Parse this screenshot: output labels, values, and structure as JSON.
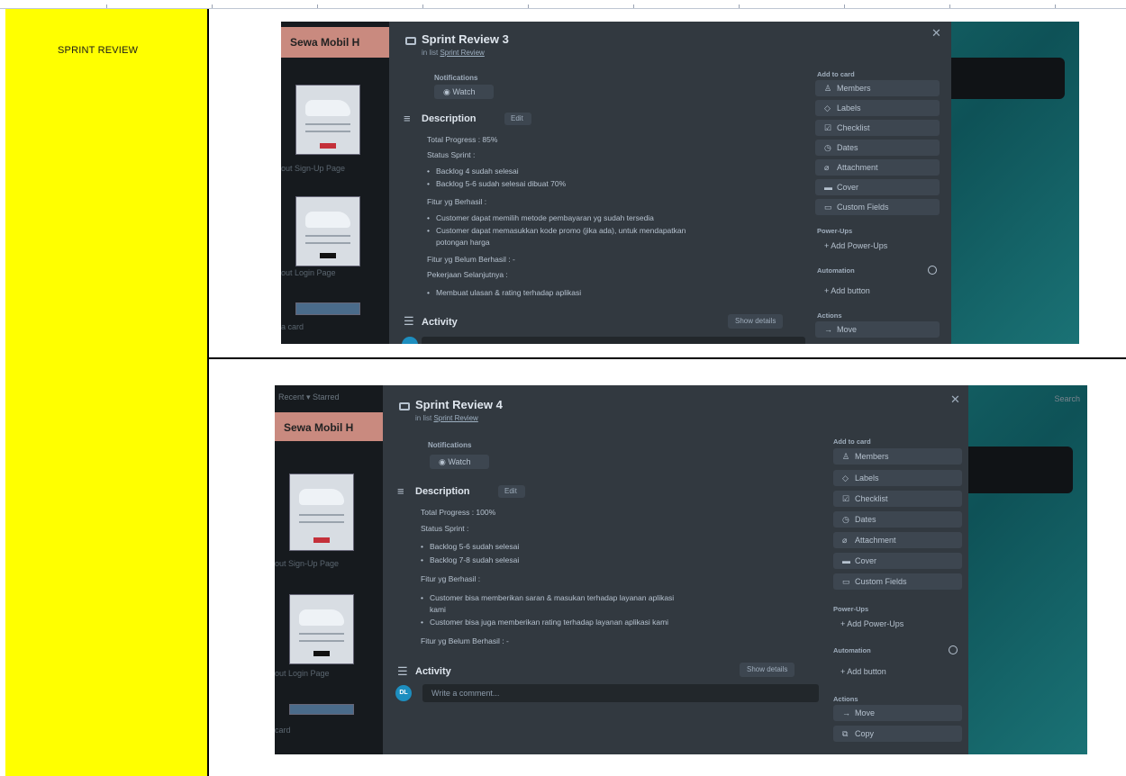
{
  "section_label": "SPRINT REVIEW",
  "review3": {
    "board_title": "Sewa Mobil H",
    "left_texts": [
      "out Sign-Up Page",
      "out Login Page",
      "a card"
    ],
    "card_title": "Sprint Review 3",
    "in_list_prefix": "in list ",
    "in_list_link": "Sprint Review",
    "notifications_label": "Notifications",
    "watch_label": "Watch",
    "description_label": "Description",
    "edit_label": "Edit",
    "lines": {
      "total_progress": "Total Progress : 85%",
      "status_sprint": "Status Sprint :",
      "status_bullets": [
        "Backlog 4 sudah selesai",
        "Backlog 5-6 sudah selesai dibuat 70%"
      ],
      "fitur_berhasil": "Fitur yg Berhasil :",
      "berhasil_bullets": [
        "Customer dapat memilih metode pembayaran yg sudah tersedia",
        "Customer dapat memasukkan kode promo (jika ada), untuk mendapatkan",
        "potongan harga"
      ],
      "fitur_belum": "Fitur yg Belum Berhasil : -",
      "pekerjaan": "Pekerjaan Selanjutnya :",
      "pekerjaan_bullets": [
        "Membuat ulasan & rating terhadap aplikasi"
      ]
    },
    "activity_label": "Activity",
    "show_details_label": "Show details",
    "add_to_card_label": "Add to card",
    "add_to_card_buttons": [
      "Members",
      "Labels",
      "Checklist",
      "Dates",
      "Attachment",
      "Cover",
      "Custom Fields"
    ],
    "powerups_label": "Power-Ups",
    "add_powerups_label": "Add Power-Ups",
    "automation_label": "Automation",
    "add_button_label": "Add button",
    "actions_label": "Actions",
    "action_buttons": [
      "Move"
    ]
  },
  "review4": {
    "top_left_text": "Recent ▾   Starred",
    "top_right_text": "Search",
    "board_title": "Sewa Mobil H",
    "left_texts": [
      "out Sign-Up Page",
      "out Login Page",
      "card"
    ],
    "card_title": "Sprint Review 4",
    "in_list_prefix": "in list ",
    "in_list_link": "Sprint Review",
    "notifications_label": "Notifications",
    "watch_label": "Watch",
    "description_label": "Description",
    "edit_label": "Edit",
    "lines": {
      "total_progress": "Total Progress : 100%",
      "status_sprint": "Status Sprint :",
      "status_bullets": [
        "Backlog 5-6 sudah selesai",
        "Backlog 7-8 sudah selesai"
      ],
      "fitur_berhasil": "Fitur yg Berhasil :",
      "berhasil_bullets": [
        "Customer bisa memberikan saran & masukan terhadap layanan aplikasi",
        "kami",
        "Customer bisa juga memberikan rating terhadap layanan aplikasi kami"
      ],
      "fitur_belum": "Fitur yg Belum Berhasil : -"
    },
    "activity_label": "Activity",
    "show_details_label": "Show details",
    "avatar_initials": "DL",
    "comment_placeholder": "Write a comment...",
    "add_to_card_label": "Add to card",
    "add_to_card_buttons": [
      "Members",
      "Labels",
      "Checklist",
      "Dates",
      "Attachment",
      "Cover",
      "Custom Fields"
    ],
    "powerups_label": "Power-Ups",
    "add_powerups_label": "Add Power-Ups",
    "automation_label": "Automation",
    "add_button_label": "Add button",
    "actions_label": "Actions",
    "action_buttons": [
      "Move",
      "Copy"
    ]
  },
  "colors": {
    "highlight": "#ffff00",
    "modal_bg": "#323940",
    "board_bg": "#0f4a4e",
    "board_title_bg": "#c98a7f"
  }
}
